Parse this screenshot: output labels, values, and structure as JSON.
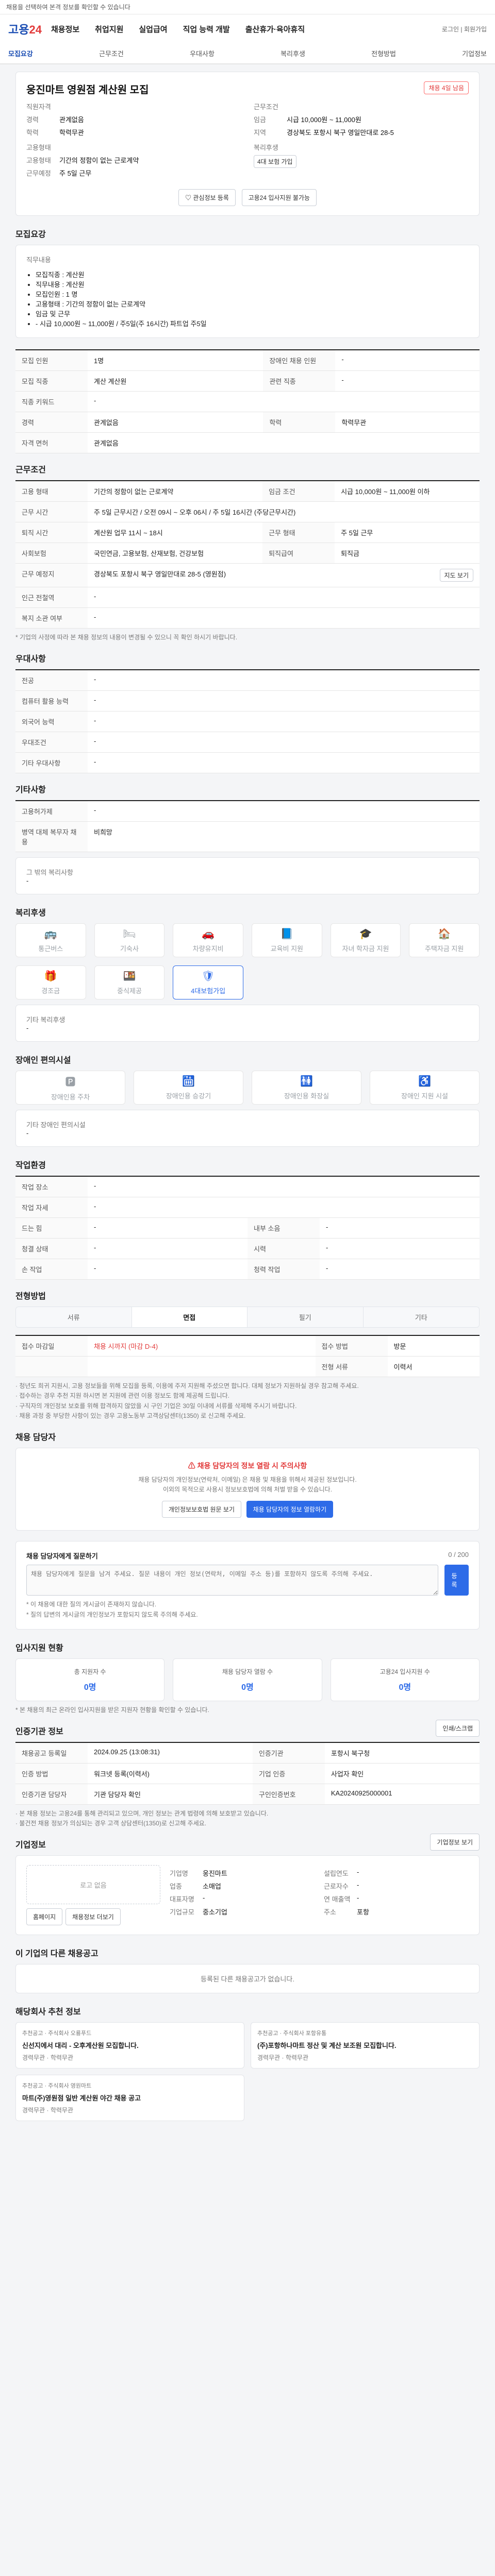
{
  "topbar": {
    "text": "채용을 선택하여 본격 정보를 확인할 수 있습니다"
  },
  "header": {
    "logo_main": "고용",
    "logo_accent": "24",
    "nav": [
      "채용정보",
      "취업지원",
      "실업급여",
      "직업 능력 개발",
      "출산휴가·육아휴직"
    ],
    "right_text": "로그인 | 회원가입"
  },
  "tabs": [
    "모집요강",
    "근무조건",
    "우대사항",
    "복리후생",
    "전형방법",
    "기업정보"
  ],
  "job": {
    "title": "웅진마트 영원점 계산원 모집",
    "status": "채용 4일 남음",
    "left": {
      "heading_company": "직원자격",
      "company_rows": [
        {
          "k": "경력",
          "v": "관계없음"
        },
        {
          "k": "학력",
          "v": "학력무관"
        }
      ],
      "heading_conditions": "고용형태",
      "conditions_rows": [
        {
          "k": "고용형태",
          "v": "기간의 정함이 없는 근로계약"
        },
        {
          "k": "근무예정",
          "v": "주 5일 근무"
        }
      ]
    },
    "right": {
      "heading": "근무조건",
      "rows": [
        {
          "k": "임금",
          "v": "시급 10,000원 ~ 11,000원"
        },
        {
          "k": "지역",
          "v": "경상북도 포항시 북구 영일만대로 28-5"
        }
      ],
      "heading_2": "복리후생",
      "badge": "4대 보험 가입"
    },
    "buttons": {
      "bookmark": "관심정보 등록",
      "compare": "고용24 입사지원 불가능"
    }
  },
  "recruit": {
    "title": "모집요강",
    "subtitle": "직무내용",
    "duties": [
      "모집직종 : 계산원",
      "직무내용 : 계산원",
      "모집인원 : 1 명",
      "고용형태 : 기간의 정함이 없는 근로계약",
      "임금 및 근무",
      "- 시급 10,000원 ~ 11,000원 / 주5일(주 16시간) 파트업 주5일"
    ],
    "rows": [
      {
        "k": "모집 인원",
        "v": "1명",
        "k2": "장애인 채용 인원",
        "v2": "-"
      },
      {
        "k": "모집 직종",
        "v": "계산 계산원",
        "k2": "관련 직종",
        "v2": "-"
      },
      {
        "k": "직종 키워드",
        "v": "-",
        "k2": "",
        "v2": ""
      },
      {
        "k": "경력",
        "v": "관계없음",
        "k2": "학력",
        "v2": "학력무관"
      },
      {
        "k": "자격 면허",
        "v": "관계없음",
        "k2": "",
        "v2": ""
      }
    ]
  },
  "work": {
    "title": "근무조건",
    "rows": [
      {
        "k": "고용 형태",
        "v": "기간의 정함이 없는 근로계약",
        "k2": "임금 조건",
        "v2": "시급 10,000원 ~ 11,000원 이하"
      },
      {
        "k": "근무 시간",
        "v": "주 5일 근무시간 / 오전 09시 ~ 오후 06시 / 주 5일 16시간 (주당근무시간)",
        "k2": "",
        "v2": ""
      },
      {
        "k": "퇴직 시간",
        "v": "계산원 업무 11시 ~ 18시",
        "k2": "근무 형태",
        "v2": "주 5일 근무"
      },
      {
        "k": "사회보험",
        "v": "국민연금, 고용보험, 산재보험, 건강보험",
        "k2": "퇴직급여",
        "v2": "퇴직금"
      },
      {
        "k": "근무 예정지",
        "v": "경상북도 포항시 북구 영일만대로 28-5 (영원점)",
        "k2": "",
        "v2": ""
      },
      {
        "k": "인근 전철역",
        "v": "-",
        "k2": "",
        "v2": ""
      },
      {
        "k": "복지 소관 여부",
        "v": "-",
        "k2": "",
        "v2": ""
      }
    ],
    "map_button": "지도 보기",
    "note": "* 기업의 사정에 따라 본 채용 정보의 내용이 변경될 수 있으니 꼭 확인 하시기 바랍니다."
  },
  "prefer": {
    "title": "우대사항",
    "rows": [
      {
        "k": "전공",
        "v": "-"
      },
      {
        "k": "컴퓨터 활용 능력",
        "v": "-"
      },
      {
        "k": "외국어 능력",
        "v": "-"
      },
      {
        "k": "우대조건",
        "v": "-"
      },
      {
        "k": "기타 우대사항",
        "v": "-"
      }
    ]
  },
  "other": {
    "title": "기타사항",
    "rows": [
      {
        "k": "고용허가제",
        "v": "-"
      },
      {
        "k": "병역 대체 복무자 채용",
        "v": "비희망"
      }
    ],
    "extra_title": "그 밖의 복리사항",
    "extra_value": "-"
  },
  "welfare": {
    "title": "복리후생",
    "items": [
      "통근버스",
      "기숙사",
      "차량유지비",
      "교육비 지원",
      "자녀 학자금 지원",
      "주택자금 지원",
      "경조금",
      "중식제공",
      "4대보험가입"
    ],
    "active_index": 8,
    "extra_title": "기타 복리후생",
    "extra_value": "-"
  },
  "accessibility": {
    "title": "장애인 편의시설",
    "items": [
      "장애인용 주차",
      "장애인용 승강기",
      "장애인용 화장실",
      "장애인 지원 시설"
    ],
    "extra_title": "기타 장애인 편의시설",
    "extra_value": "-"
  },
  "env": {
    "title": "작업환경",
    "rows": [
      {
        "k": "작업 장소",
        "v": "-",
        "k2": "",
        "v2": ""
      },
      {
        "k": "작업 자세",
        "v": "-",
        "k2": "",
        "v2": ""
      },
      {
        "k": "드는 힘",
        "v": "-",
        "k2": "내부 소음",
        "v2": "-"
      },
      {
        "k": "청결 상태",
        "v": "-",
        "k2": "시력",
        "v2": "-"
      },
      {
        "k": "손 작업",
        "v": "-",
        "k2": "청력 작업",
        "v2": "-"
      }
    ]
  },
  "process": {
    "title": "전형방법",
    "steps": [
      "서류",
      "면접",
      "필기",
      "기타"
    ],
    "active": 1,
    "rows": [
      {
        "k": "접수 마감일",
        "v": "채용 시까지 (마감 D-4)",
        "k2": "접수 방법",
        "v2": "방문"
      },
      {
        "k": "",
        "v": "",
        "k2": "전형 서류",
        "v2": "이력서"
      }
    ],
    "notes": [
      "· 청년도 희귀 지원시, 고용 정보들을 위해 모집을 등록, 이용에 주저 지원해 주셨으면 합니다. 대체 정보가 지원하실 경우 참고해 주세요.",
      "· 접수하는 경우 추천 지원 하시면 본 지원에 관련 이용 정보도 함께 제공해 드립니다.",
      "· 구직자의 개인정보 보호를 위해 합격하지 않았을 시 구인 기업은 30일 이내에 서류를 삭제해 주시기 바랍니다.",
      "· 채용 과정 중 부당한 사항이 있는 경우 고용노동부 고객상담센터(1350) 로 신고해 주세요."
    ]
  },
  "contact": {
    "title": "채용 담당자",
    "alert_title": "채용 담당자의 정보 열람 시 주의사항",
    "alert_lines": [
      "채용 담당자의 개인정보(연락처, 이메일) 은 채용 및 채용을 위해서 제공된 정보입니다.",
      "이외의 목적으로 사용시 정보보호법에 의해 처벌 받을 수 있습니다."
    ],
    "buttons": [
      "개인정보보호법 원문 보기",
      "채용 담당자의 정보 열람하기"
    ]
  },
  "qna": {
    "title": "채용 담당자에게 질문하기",
    "counter": "0 / 200",
    "placeholder": "채용 담당자에게 질문을 남겨 주세요. 질문 내용이 개인 정보(연락처, 이메일 주소 등)를 포함하지 않도록 주의해 주세요.",
    "submit": "등록",
    "notes": [
      "* 이 채용에 대한 질의 게시글이 존재하지 않습니다.",
      "* 질의 답변의 게시글의 개인정보가 포함되지 않도록 주의해 주세요."
    ]
  },
  "apply_status": {
    "title": "입사지원 현황",
    "items": [
      {
        "label": "총 지원자 수",
        "value": "0명"
      },
      {
        "label": "채용 담당자 열람 수",
        "value": "0명"
      },
      {
        "label": "고용24 입사지원 수",
        "value": "0명"
      }
    ],
    "note": "* 본 채용의 최근 온라인 입사지원을 받은 지원자 현황을 확인할 수 있습니다."
  },
  "admin": {
    "title": "인증기관 정보",
    "print_button": "인쇄/스크랩",
    "rows": [
      {
        "k": "채용공고 등록일",
        "v": "2024.09.25 (13:08:31)",
        "k2": "인증기관",
        "v2": "포항시 북구청"
      },
      {
        "k": "인증 방법",
        "v": "워크넷 등록(이력서)",
        "k2": "기업 인증",
        "v2": "사업자 확인"
      },
      {
        "k": "인증기관 담당자",
        "v": "기관 담당자 확인",
        "k2": "구인인증번호",
        "v2": "KA20240925000001"
      }
    ],
    "notes": [
      "· 본 채용 정보는 고용24를 통해 관리되고 있으며, 개인 정보는 관계 법령에 의해 보호받고 있습니다.",
      "· 불건전 채용 정보가 의심되는 경우 고객 상담센터(1350)로 신고해 주세요."
    ]
  },
  "company": {
    "title": "기업정보",
    "subtitle_right": "기업정보 보기",
    "logo_alt": "로고 없음",
    "logo_buttons": [
      "홈페이지",
      "채용정보 더보기"
    ],
    "rows_left": [
      {
        "k": "기업명",
        "v": "웅진마트"
      },
      {
        "k": "업종",
        "v": "소매업"
      },
      {
        "k": "대표자명",
        "v": "-"
      },
      {
        "k": "기업규모",
        "v": "중소기업"
      }
    ],
    "rows_right": [
      {
        "k": "설립연도",
        "v": "-"
      },
      {
        "k": "근로자수",
        "v": "-"
      },
      {
        "k": "연 매출액",
        "v": "-"
      },
      {
        "k": "주소",
        "v": "포항"
      }
    ]
  },
  "other_jobs": {
    "title": "이 기업의 다른 채용공고",
    "empty": "등록된 다른 채용공고가 없습니다."
  },
  "recommend": {
    "title": "해당회사 추천 정보",
    "items": [
      {
        "tag": "추천공고",
        "org": "주식회사 오룡푸드",
        "title": "신선지에서 대리 - 오후계산원 모집합니다.",
        "meta": [
          "경력무관",
          "학력무관"
        ]
      },
      {
        "tag": "추천공고",
        "org": "주식회사 포항유통",
        "title": "(주)포항하나마트 정산 및 계산 보조원 모집합니다.",
        "meta": [
          "경력무관",
          "학력무관"
        ]
      },
      {
        "tag": "추천공고",
        "org": "주식회사 영원마트",
        "title": "마트(주)영원점 일반 계산원 야간 채용 공고",
        "meta": [
          "경력무관",
          "학력무관"
        ]
      }
    ]
  },
  "colors": {
    "primary": "#2d6be8",
    "accent": "#e23b3b"
  }
}
